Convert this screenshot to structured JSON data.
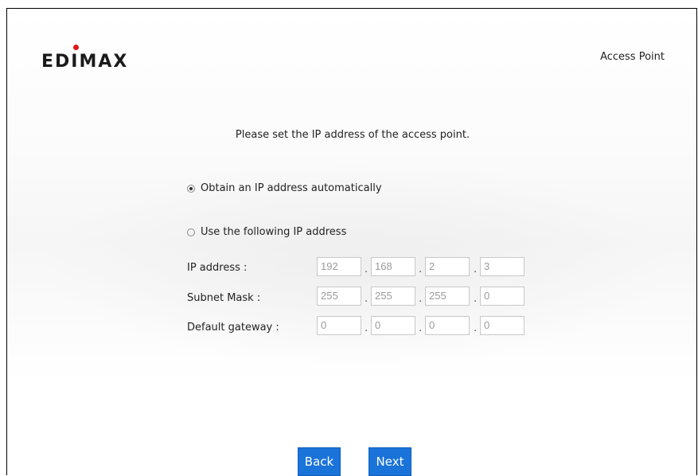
{
  "header": {
    "logo_text": "EDIMAX",
    "mode_label": "Access Point"
  },
  "main": {
    "instruction": "Please set the IP address of the access point.",
    "options": [
      {
        "label": "Obtain an IP address automatically",
        "selected": true
      },
      {
        "label": "Use the following IP address",
        "selected": false
      }
    ],
    "fields": [
      {
        "label": "IP address :",
        "octets": [
          "192",
          "168",
          "2",
          "3"
        ]
      },
      {
        "label": "Subnet Mask :",
        "octets": [
          "255",
          "255",
          "255",
          "0"
        ]
      },
      {
        "label": "Default gateway :",
        "octets": [
          "0",
          "0",
          "0",
          "0"
        ]
      }
    ],
    "separator": "."
  },
  "footer": {
    "back_label": "Back",
    "next_label": "Next"
  },
  "colors": {
    "button_bg": "#1a73d9",
    "logo_dot": "#e0161b"
  }
}
